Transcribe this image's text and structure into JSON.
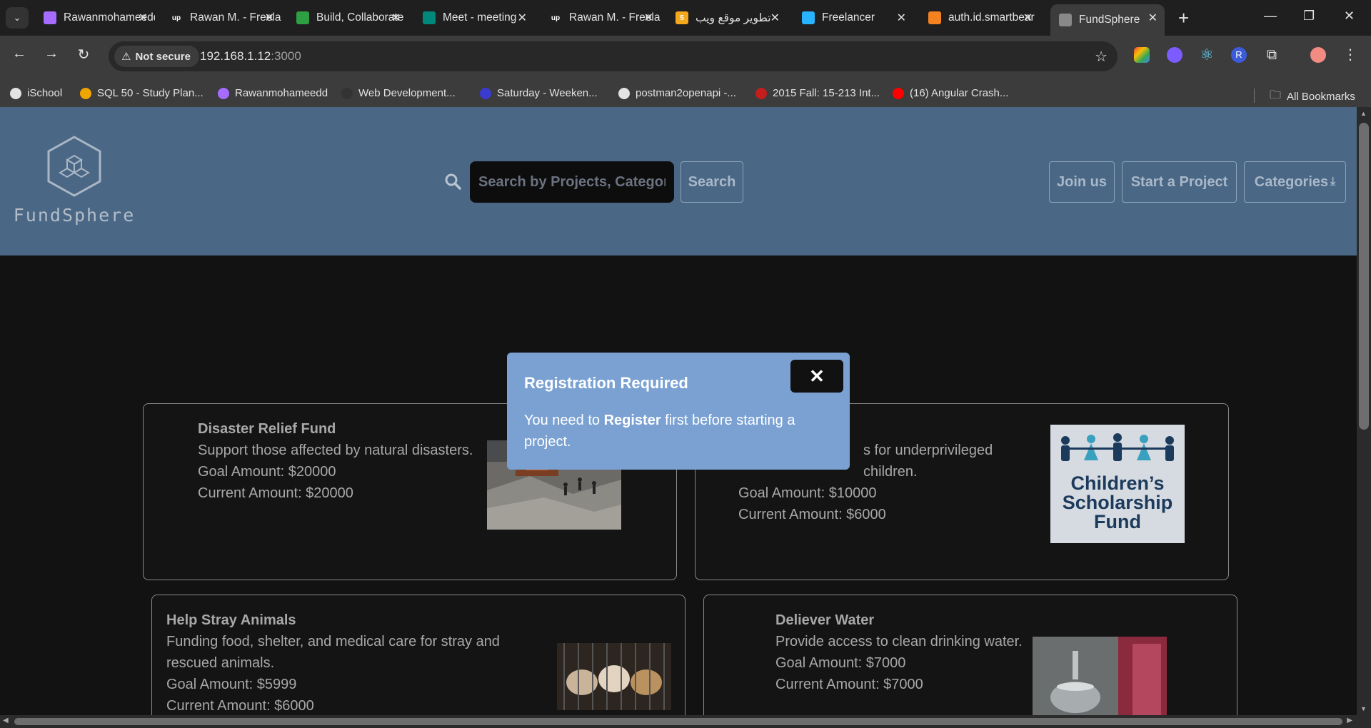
{
  "browser": {
    "tabs": [
      {
        "label": "Rawanmohameedd",
        "favicon_color": "#a66cff",
        "favicon_text": ""
      },
      {
        "label": "Rawan M. - Freelancer",
        "favicon_color": "#1f1f1f",
        "favicon_text": "up"
      },
      {
        "label": "Build, Collaborate",
        "favicon_color": "#2ea043",
        "favicon_text": ""
      },
      {
        "label": "Meet - meeting",
        "favicon_color": "#00897b",
        "favicon_text": ""
      },
      {
        "label": "Rawan M. - Freelancer",
        "favicon_color": "#1f1f1f",
        "favicon_text": "up"
      },
      {
        "label": "تطوير موقع ويب",
        "favicon_color": "#f4a81d",
        "favicon_text": "5"
      },
      {
        "label": "Freelancer",
        "favicon_color": "#29b2fe",
        "favicon_text": ""
      },
      {
        "label": "auth.id.smartbear",
        "favicon_color": "#f58220",
        "favicon_text": ""
      },
      {
        "label": "FundSphere",
        "favicon_color": "#888888",
        "favicon_text": "",
        "active": true
      }
    ],
    "new_tab_label": "+",
    "minimize": "—",
    "restore": "❐",
    "close": "✕",
    "not_secure_label": "Not secure",
    "url_host": "192.168.1.12",
    "url_port": ":3000",
    "bookmarks": [
      {
        "label": "iSchool",
        "color": "#e3e3e3"
      },
      {
        "label": "SQL 50 - Study Plan...",
        "color": "#f0a500"
      },
      {
        "label": "Rawanmohameedd",
        "color": "#a66cff"
      },
      {
        "label": "Web Development...",
        "color": "#333333"
      },
      {
        "label": "Saturday - Weeken...",
        "color": "#3b3bd1"
      },
      {
        "label": "postman2openapi -...",
        "color": "#e3e3e3"
      },
      {
        "label": "2015 Fall: 15-213 Int...",
        "color": "#c41e1e"
      },
      {
        "label": "(16) Angular Crash...",
        "color": "#ff0000"
      }
    ],
    "all_bookmarks": "All Bookmarks"
  },
  "header": {
    "logo_text": "FundSphere",
    "search_placeholder": "Search by Projects, Categories",
    "search_button": "Search",
    "join_button": "Join us",
    "start_button": "Start a Project",
    "categories_button": "Categories"
  },
  "projects": [
    {
      "title": "Disaster Relief Fund",
      "description": "Support those affected by natural disasters.",
      "goal": "Goal Amount: $20000",
      "current": "Current Amount: $20000"
    },
    {
      "title": "",
      "description": "s for underprivileged children.",
      "goal": "Goal Amount: $10000",
      "current": "Current Amount: $6000",
      "image_text": [
        "Children’s",
        "Scholarship",
        "Fund"
      ]
    },
    {
      "title": "Help Stray Animals",
      "description": "Funding food, shelter, and medical care for stray and rescued animals.",
      "goal": "Goal Amount: $5999",
      "current": "Current Amount: $6000"
    },
    {
      "title": "Deliever Water",
      "description": "Provide access to clean drinking water.",
      "goal": "Goal Amount: $7000",
      "current": "Current Amount: $7000"
    }
  ],
  "modal": {
    "title": "Registration Required",
    "close_label": "✕",
    "body_prefix": "You need to ",
    "body_emphasis": "Register",
    "body_suffix": " first before starting a project."
  }
}
